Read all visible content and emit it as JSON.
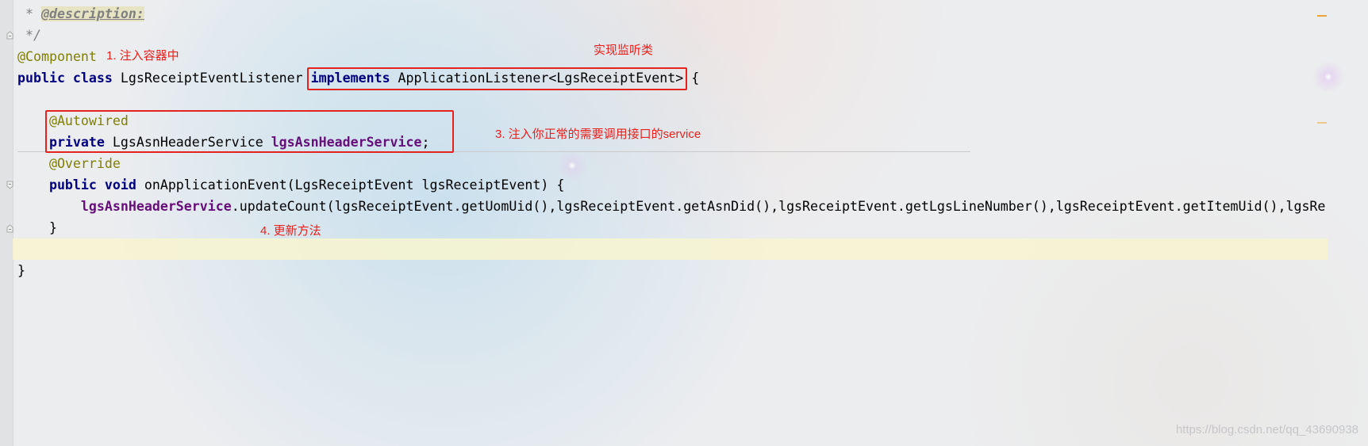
{
  "editor": {
    "lines": [
      [
        " * ",
        "@description:"
      ],
      [
        " */"
      ],
      [
        "@Component"
      ],
      [
        "public class",
        " LgsReceiptEventListener ",
        "implements",
        " ApplicationListener<LgsReceiptEvent>",
        " {"
      ],
      [],
      [
        "@Autowired"
      ],
      [
        "private",
        " LgsAsnHeaderService ",
        "lgsAsnHeaderService",
        ";"
      ],
      [
        "@Override"
      ],
      [
        "public void",
        " onApplicationEvent(LgsReceiptEvent lgsReceiptEvent) {"
      ],
      [
        "lgsAsnHeaderService",
        ".updateCount(lgsReceiptEvent.getUomUid(),lgsReceiptEvent.getAsnDid(),lgsReceiptEvent.getLgsLineNumber(),lgsReceiptEvent.getItemUid(),lgsRe"
      ],
      [
        "}"
      ],
      [],
      [
        "}"
      ]
    ]
  },
  "markup": {
    "note_inject_container": "1. 注入容器中",
    "note_implements_listener": "实现监听类",
    "note_inject_service": "3. 注入你正常的需要调用接口的service",
    "note_update_method": "4. 更新方法"
  },
  "watermark": "https://blog.csdn.net/qq_43690938",
  "icons": {
    "gutter": "fold-marker-icon"
  },
  "colors": {
    "keyword": "#000080",
    "annotation": "#808000",
    "field": "#660e7a",
    "comment": "#808080",
    "markup_red": "#e4221e",
    "current_line": "#f8f5d0"
  }
}
